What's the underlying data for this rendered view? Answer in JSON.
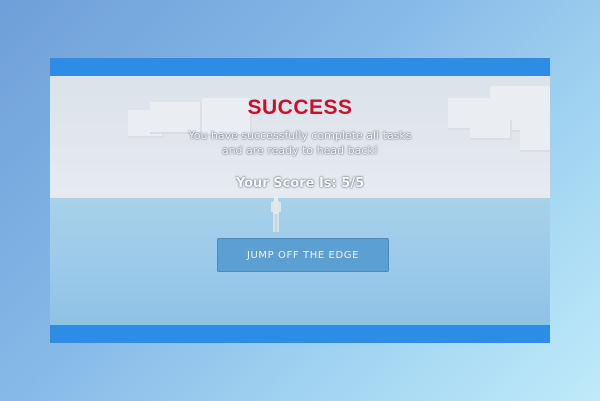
{
  "dialog": {
    "title": "SUCCESS",
    "message_line1": "You have successfully complete all tasks",
    "message_line2": "and are ready to head back!",
    "score_text": "Your Score Is: 5/5",
    "jump_button_label": "JUMP OFF THE EDGE"
  },
  "colors": {
    "title": "#c8102e",
    "bar": "#2d8de6",
    "button": "#5b9fd3"
  }
}
